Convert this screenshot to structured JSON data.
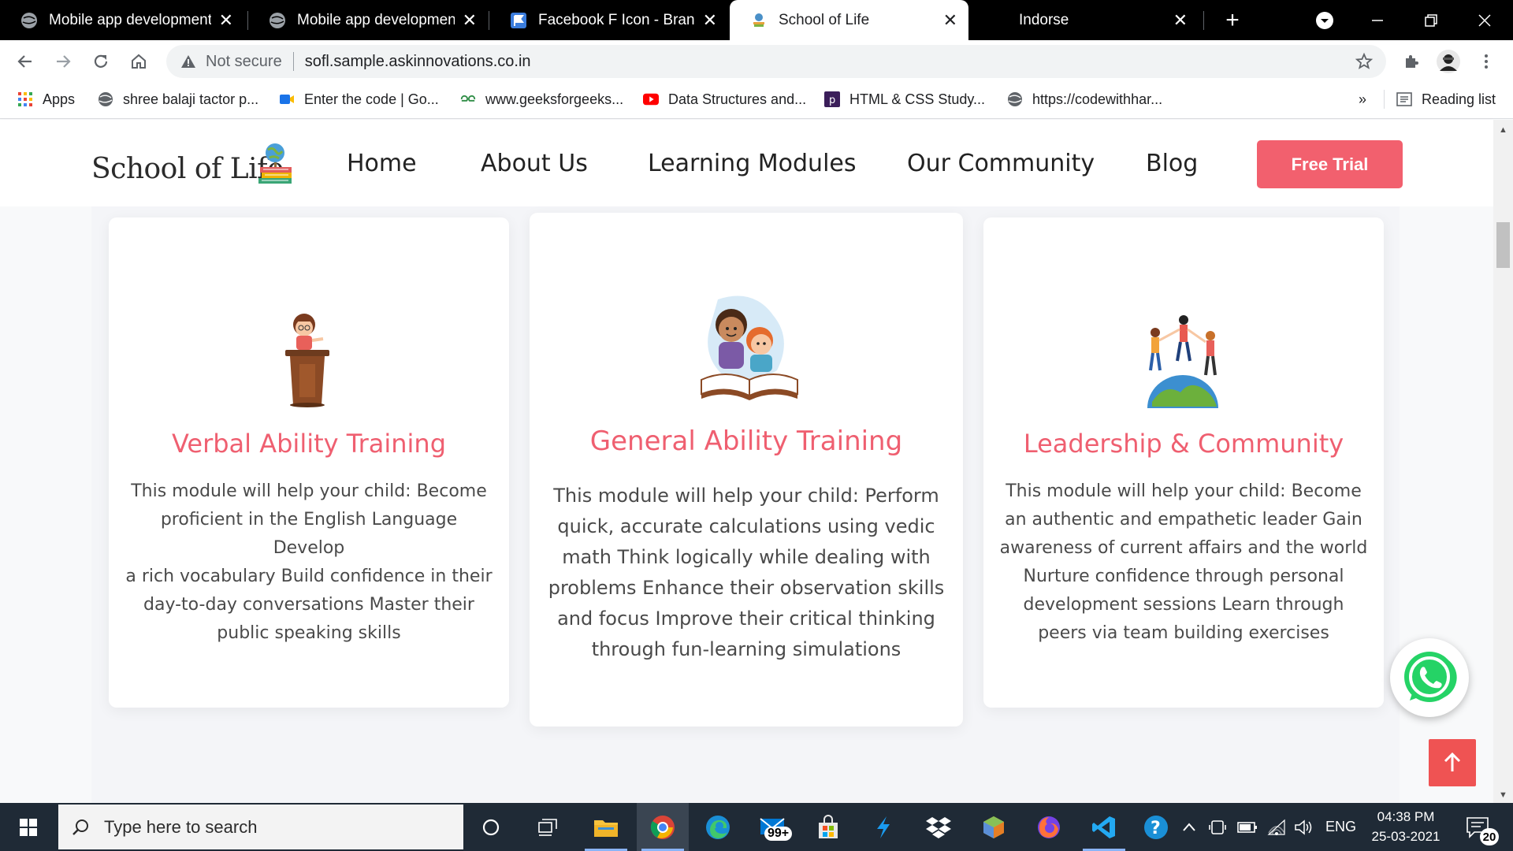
{
  "browser": {
    "tabs": [
      {
        "title": "Mobile app development",
        "favicon": "globe-icon"
      },
      {
        "title": "Mobile app development",
        "favicon": "globe-icon"
      },
      {
        "title": "Facebook F Icon - Brands |",
        "favicon": "flag-icon"
      },
      {
        "title": "School of Life",
        "favicon": "site-icon",
        "active": true
      },
      {
        "title": "Indorse",
        "favicon": "none"
      }
    ],
    "address": {
      "security_label": "Not secure",
      "url": "sofl.sample.askinnovations.co.in"
    },
    "bookmarks": [
      {
        "label": "Apps",
        "icon": "apps-grid-icon"
      },
      {
        "label": "shree balaji tactor p...",
        "icon": "globe-icon"
      },
      {
        "label": "Enter the code | Go...",
        "icon": "meet-icon"
      },
      {
        "label": "www.geeksforgeeks...",
        "icon": "gfg-icon"
      },
      {
        "label": "Data Structures and...",
        "icon": "youtube-icon"
      },
      {
        "label": "HTML & CSS Study...",
        "icon": "p-icon"
      },
      {
        "label": "https://codewithhar...",
        "icon": "globe-icon"
      }
    ],
    "overflow_label": "»",
    "reading_list_label": "Reading list"
  },
  "site": {
    "logo_text": "School of Life",
    "nav": [
      "Home",
      "About Us",
      "Learning Modules",
      "Our Community",
      "Blog"
    ],
    "cta_label": "Free Trial",
    "accent_color": "#ef5f70",
    "cards": [
      {
        "title": "Verbal Ability Training",
        "lines": [
          "This module will help your child: Become",
          "proficient in the English Language Develop",
          "a rich vocabulary Build confidence in their",
          "day-to-day conversations Master their",
          "public speaking skills"
        ],
        "illustration": "girl-at-podium-icon"
      },
      {
        "title": "General Ability Training",
        "lines": [
          "This module will help your child: Perform",
          "quick, accurate calculations using vedic",
          "math Think logically while dealing with",
          "problems Enhance their observation skills",
          "and focus Improve their critical thinking",
          "through fun-learning simulations"
        ],
        "illustration": "kids-reading-book-icon"
      },
      {
        "title": "Leadership & Community",
        "lines": [
          "This module will help your child: Become",
          "an authentic and empathetic leader Gain",
          "awareness of current affairs and the world",
          "Nurture confidence through personal",
          "development sessions Learn through",
          "peers via team building exercises"
        ],
        "illustration": "kids-on-globe-icon"
      }
    ]
  },
  "taskbar": {
    "search_placeholder": "Type here to search",
    "mail_badge": "99+",
    "language": "ENG",
    "time": "04:38 PM",
    "date": "25-03-2021",
    "notification_count": "20"
  }
}
